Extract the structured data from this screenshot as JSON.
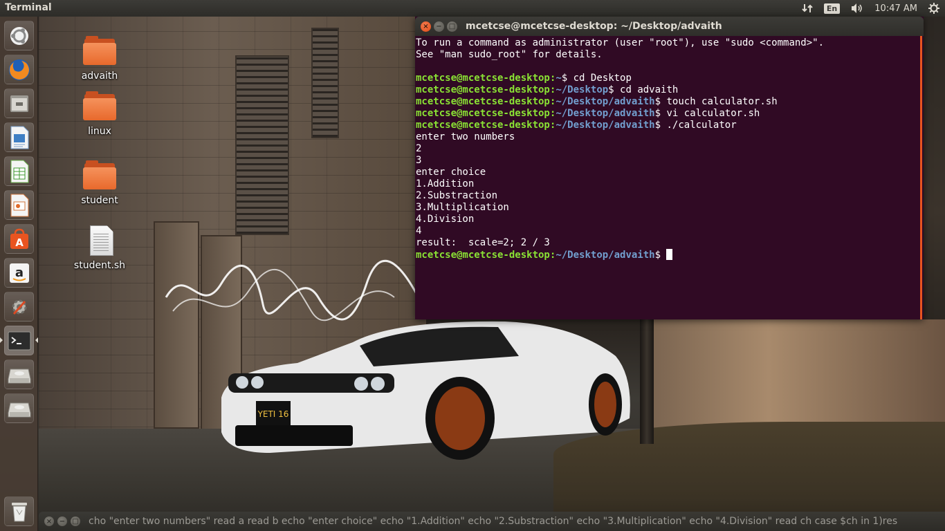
{
  "top_panel": {
    "title": "Terminal",
    "keyboard_layout": "En",
    "time": "10:47 AM"
  },
  "launcher": {
    "items": [
      {
        "name": "dash-home",
        "icon": "ubuntu-logo-icon"
      },
      {
        "name": "firefox",
        "icon": "firefox-icon"
      },
      {
        "name": "files",
        "icon": "file-manager-icon"
      },
      {
        "name": "libreoffice-writer",
        "icon": "writer-icon"
      },
      {
        "name": "libreoffice-calc",
        "icon": "calc-icon"
      },
      {
        "name": "libreoffice-impress",
        "icon": "impress-icon"
      },
      {
        "name": "software-center",
        "icon": "software-center-icon"
      },
      {
        "name": "amazon",
        "icon": "amazon-icon"
      },
      {
        "name": "system-settings",
        "icon": "settings-icon"
      },
      {
        "name": "terminal",
        "icon": "terminal-icon"
      },
      {
        "name": "drive-1",
        "icon": "drive-icon"
      },
      {
        "name": "drive-2",
        "icon": "drive-icon"
      },
      {
        "name": "trash",
        "icon": "trash-icon"
      }
    ]
  },
  "desktop": {
    "icons": [
      {
        "label": "advaith",
        "type": "folder"
      },
      {
        "label": "linux",
        "type": "folder"
      },
      {
        "label": "student",
        "type": "folder"
      },
      {
        "label": "student.sh",
        "type": "file"
      }
    ]
  },
  "terminal": {
    "title": "mcetcse@mcetcse-desktop: ~/Desktop/advaith",
    "lines": [
      {
        "kind": "text",
        "text": "To run a command as administrator (user \"root\"), use \"sudo <command>\"."
      },
      {
        "kind": "text",
        "text": "See \"man sudo_root\" for details."
      },
      {
        "kind": "text",
        "text": ""
      },
      {
        "kind": "prompt",
        "user": "mcetcse@mcetcse-desktop",
        "path": "~",
        "cmd": " cd Desktop"
      },
      {
        "kind": "prompt",
        "user": "mcetcse@mcetcse-desktop",
        "path": "~/Desktop",
        "cmd": " cd advaith"
      },
      {
        "kind": "prompt",
        "user": "mcetcse@mcetcse-desktop",
        "path": "~/Desktop/advaith",
        "cmd": " touch calculator.sh"
      },
      {
        "kind": "prompt",
        "user": "mcetcse@mcetcse-desktop",
        "path": "~/Desktop/advaith",
        "cmd": " vi calculator.sh"
      },
      {
        "kind": "prompt",
        "user": "mcetcse@mcetcse-desktop",
        "path": "~/Desktop/advaith",
        "cmd": " ./calculator"
      },
      {
        "kind": "text",
        "text": "enter two numbers"
      },
      {
        "kind": "text",
        "text": "2"
      },
      {
        "kind": "text",
        "text": "3"
      },
      {
        "kind": "text",
        "text": "enter choice"
      },
      {
        "kind": "text",
        "text": "1.Addition"
      },
      {
        "kind": "text",
        "text": "2.Substraction"
      },
      {
        "kind": "text",
        "text": "3.Multiplication"
      },
      {
        "kind": "text",
        "text": "4.Division"
      },
      {
        "kind": "text",
        "text": "4"
      },
      {
        "kind": "text",
        "text": "result:  scale=2; 2 / 3"
      },
      {
        "kind": "prompt",
        "user": "mcetcse@mcetcse-desktop",
        "path": "~/Desktop/advaith",
        "cmd": " ",
        "cursor": true
      }
    ]
  },
  "minimized_window": {
    "title": "cho \"enter two numbers\" read a read b echo \"enter choice\" echo \"1.Addition\" echo \"2.Substraction\" echo \"3.Multiplication\" echo \"4.Division\" read ch case $ch in 1)res"
  },
  "colors": {
    "terminal_bg": "#300a24",
    "prompt_user": "#8ae234",
    "prompt_path": "#729fcf",
    "ubuntu_orange": "#e95420",
    "panel_bg": "#3c3b37"
  }
}
